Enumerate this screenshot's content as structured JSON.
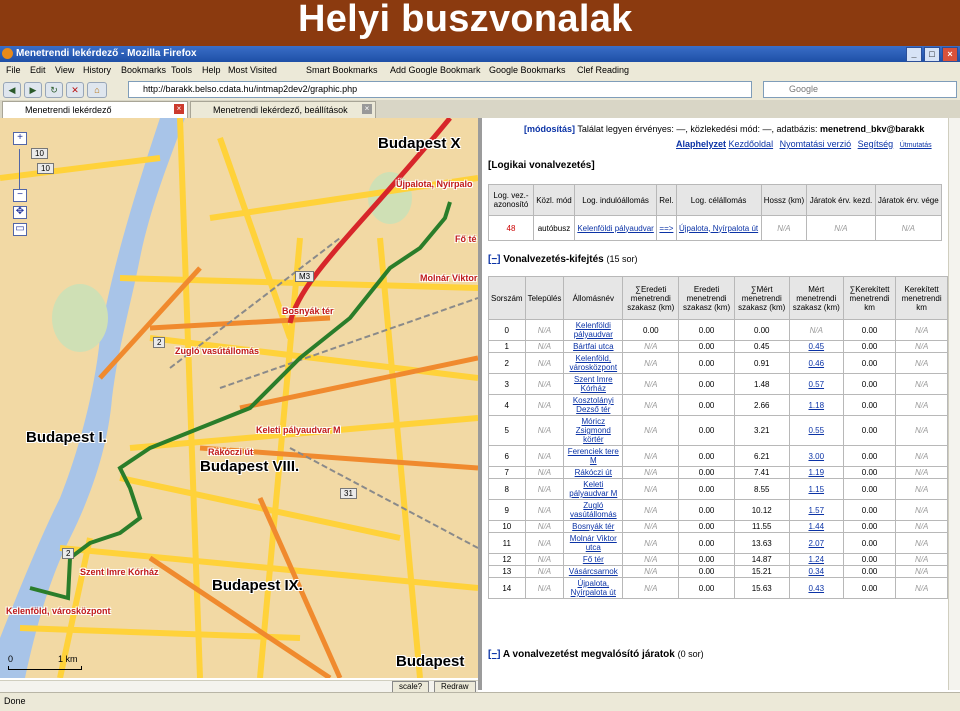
{
  "slide": {
    "title": "Helyi buszvonalak"
  },
  "window": {
    "title": "Menetrendi lekérdező - Mozilla Firefox",
    "menu": [
      "File",
      "Edit",
      "View",
      "History",
      "Bookmarks",
      "Tools",
      "Help"
    ],
    "bookmarks": [
      "Most Visited",
      "Smart Bookmarks",
      "Add Google Bookmark",
      "Google Bookmarks",
      "Clef Reading"
    ],
    "url": "http://barakk.belso.cdata.hu/intmap2dev2/graphic.php",
    "search_placeholder": "Google",
    "tabs": [
      "Menetrendi lekérdező",
      "Menetrendi lekérdező, beállítások"
    ],
    "status": "Done"
  },
  "map": {
    "district_labels": [
      "Budapest X",
      "Budapest I.",
      "Budapest VIII.",
      "Budapest IX.",
      "Budapest"
    ],
    "stops": [
      "Bosnyák tér",
      "Zugló vasútállomás",
      "Keleti pályaudvar M",
      "Rákóczi út",
      "Szent Imre Kórház",
      "Kelenföld, városközpont",
      "Újpalota, Nyírpalo",
      "Fő té",
      "Molnár Viktor"
    ],
    "scale": {
      "left": "0",
      "right": "1 km"
    },
    "bottom_buttons": [
      "scale?",
      "Redraw"
    ],
    "road_tags": [
      "10",
      "10",
      "M3",
      "2",
      "31",
      "2"
    ]
  },
  "panel": {
    "header": {
      "modify": "[módosítás]",
      "summary": "Találat legyen érvényes: —, közlekedési mód: —, adatbázis:",
      "db": "menetrend_bkv@barakk",
      "links": [
        "Alaphelyzet",
        "Kezdőoldal",
        "Nyomtatási verzió",
        "Segítség",
        "Útmutatás"
      ]
    },
    "logical_title": "[Logikai vonalvezetés]",
    "logical_table": {
      "headers": [
        "Log. vez.-azonosító",
        "Közl. mód",
        "Log. indulóállomás",
        "Rel.",
        "Log. célállomás",
        "Hossz (km)",
        "Járatok érv. kezd.",
        "Járatok érv. vége"
      ],
      "row": [
        "48",
        "autóbusz",
        "Kelenföldi pályaudvar",
        "==>",
        "Újpalota, Nyírpalota út",
        "N/A",
        "N/A",
        "N/A"
      ]
    },
    "route_title": {
      "toggle": "[−]",
      "text": "Vonalvezetés-kifejtés",
      "count": "(15 sor)"
    },
    "route_table": {
      "headers": [
        "Sorszám",
        "Település",
        "Állomásnév",
        "∑Eredeti menetrendi szakasz (km)",
        "Eredeti menetrendi szakasz (km)",
        "∑Mért menetrendi szakasz (km)",
        "Mért menetrendi szakasz (km)",
        "∑Kerekített menetrendi km",
        "Kerekített menetrendi km"
      ],
      "rows": [
        [
          "0",
          "N/A",
          "Kelenföldi pályaudvar",
          "0.00",
          "0.00",
          "0.00",
          "N/A",
          "0.00",
          "N/A"
        ],
        [
          "1",
          "N/A",
          "Bártfai utca",
          "N/A",
          "0.00",
          "0.45",
          "0.45",
          "0.00",
          "N/A"
        ],
        [
          "2",
          "N/A",
          "Kelenföld, városközpont",
          "N/A",
          "0.00",
          "0.91",
          "0.46",
          "0.00",
          "N/A"
        ],
        [
          "3",
          "N/A",
          "Szent Imre Kórház",
          "N/A",
          "0.00",
          "1.48",
          "0.57",
          "0.00",
          "N/A"
        ],
        [
          "4",
          "N/A",
          "Kosztolányi Dezső tér",
          "N/A",
          "0.00",
          "2.66",
          "1.18",
          "0.00",
          "N/A"
        ],
        [
          "5",
          "N/A",
          "Móricz Zsigmond körtér",
          "N/A",
          "0.00",
          "3.21",
          "0.55",
          "0.00",
          "N/A"
        ],
        [
          "6",
          "N/A",
          "Ferenciek tere M",
          "N/A",
          "0.00",
          "6.21",
          "3.00",
          "0.00",
          "N/A"
        ],
        [
          "7",
          "N/A",
          "Rákóczi út",
          "N/A",
          "0.00",
          "7.41",
          "1.19",
          "0.00",
          "N/A"
        ],
        [
          "8",
          "N/A",
          "Keleti pályaudvar M",
          "N/A",
          "0.00",
          "8.55",
          "1.15",
          "0.00",
          "N/A"
        ],
        [
          "9",
          "N/A",
          "Zugló vasútállomás",
          "N/A",
          "0.00",
          "10.12",
          "1.57",
          "0.00",
          "N/A"
        ],
        [
          "10",
          "N/A",
          "Bosnyák tér",
          "N/A",
          "0.00",
          "11.55",
          "1.44",
          "0.00",
          "N/A"
        ],
        [
          "11",
          "N/A",
          "Molnár Viktor utca",
          "N/A",
          "0.00",
          "13.63",
          "2.07",
          "0.00",
          "N/A"
        ],
        [
          "12",
          "N/A",
          "Fő tér",
          "N/A",
          "0.00",
          "14.87",
          "1.24",
          "0.00",
          "N/A"
        ],
        [
          "13",
          "N/A",
          "Vásárcsarnok",
          "N/A",
          "0.00",
          "15.21",
          "0.34",
          "0.00",
          "N/A"
        ],
        [
          "14",
          "N/A",
          "Újpalota, Nyírpalota út",
          "N/A",
          "0.00",
          "15.63",
          "0.43",
          "0.00",
          "N/A"
        ]
      ]
    },
    "trips_title": {
      "toggle": "[−]",
      "text": "A vonalvezetést megvalósító járatok",
      "count": "(0 sor)"
    }
  }
}
